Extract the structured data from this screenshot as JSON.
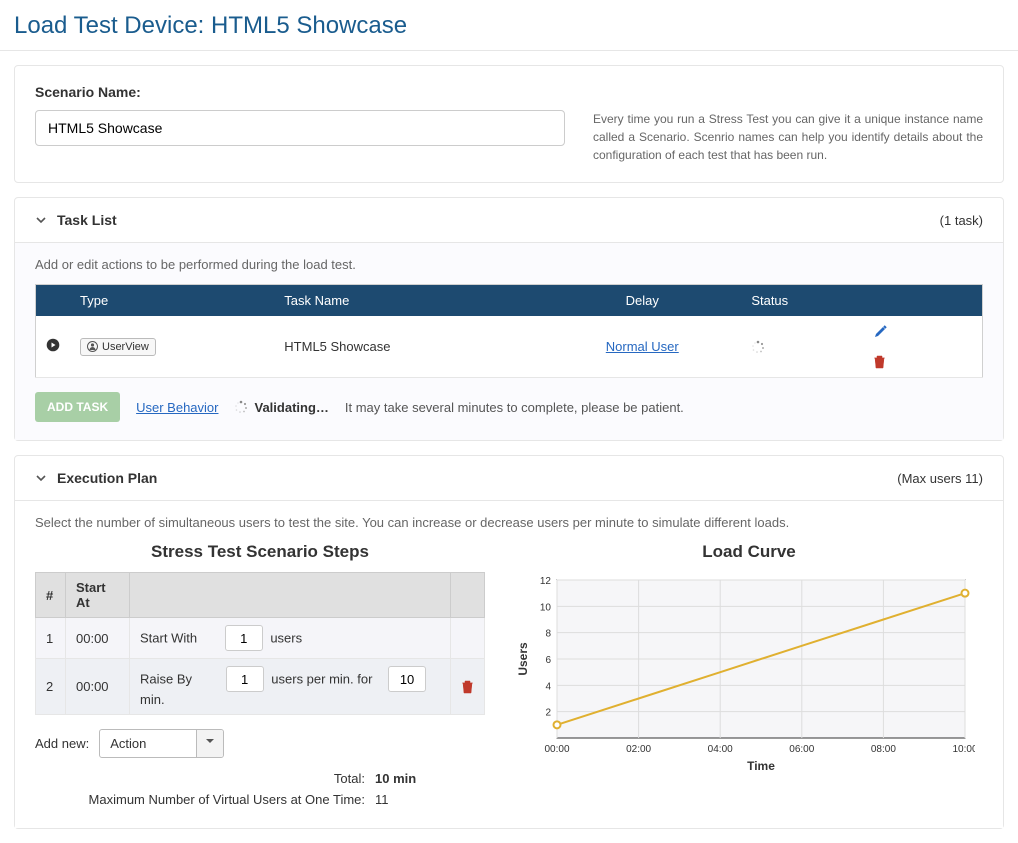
{
  "page_title": "Load Test Device: HTML5 Showcase",
  "scenario": {
    "label": "Scenario Name:",
    "value": "HTML5 Showcase",
    "help": "Every time you run a Stress Test you can give it a unique instance name called a Scenario. Scenrio names can help you identify details about the configuration of each test that has been run."
  },
  "task_list": {
    "title": "Task List",
    "meta": "(1 task)",
    "help": "Add or edit actions to be performed during the load test.",
    "columns": {
      "type": "Type",
      "name": "Task Name",
      "delay": "Delay",
      "status": "Status"
    },
    "row": {
      "badge": "UserView",
      "name": "HTML5 Showcase",
      "delay": "Normal User"
    },
    "add_btn": "ADD TASK",
    "user_behavior": "User Behavior",
    "validating": "Validating…",
    "patient": "It may take several minutes to complete, please be patient."
  },
  "exec": {
    "title": "Execution Plan",
    "meta": "(Max users 11)",
    "help": "Select the number of simultaneous users to test the site. You can increase or decrease users per minute to simulate different loads.",
    "steps_title": "Stress Test Scenario Steps",
    "cols": {
      "num": "#",
      "start": "Start At"
    },
    "rows": [
      {
        "num": "1",
        "time": "00:00",
        "label_a": "Start With",
        "val_a": "1",
        "unit_a": "users"
      },
      {
        "num": "2",
        "time": "00:00",
        "label_a": "Raise By",
        "val_a": "1",
        "unit_a": "users per min. for",
        "val_b": "10",
        "unit_b": "min."
      }
    ],
    "add_new_label": "Add new:",
    "combo": "Action",
    "total_label": "Total:",
    "total_val": "10 min",
    "max_label": "Maximum Number of Virtual Users at One Time:",
    "max_val": "11",
    "curve_title": "Load Curve"
  },
  "chart_data": {
    "type": "line",
    "title": "Load Curve",
    "xlabel": "Time",
    "ylabel": "Users",
    "x_ticks": [
      "00:00",
      "02:00",
      "04:00",
      "06:00",
      "08:00",
      "10:00"
    ],
    "y_ticks": [
      2,
      4,
      6,
      8,
      10,
      12
    ],
    "ylim": [
      0,
      12
    ],
    "series": [
      {
        "name": "Users",
        "points": [
          {
            "x": "00:00",
            "y": 1
          },
          {
            "x": "02:00",
            "y": 3
          },
          {
            "x": "04:00",
            "y": 5
          },
          {
            "x": "06:00",
            "y": 7
          },
          {
            "x": "08:00",
            "y": 9
          },
          {
            "x": "10:00",
            "y": 11
          }
        ]
      }
    ]
  }
}
